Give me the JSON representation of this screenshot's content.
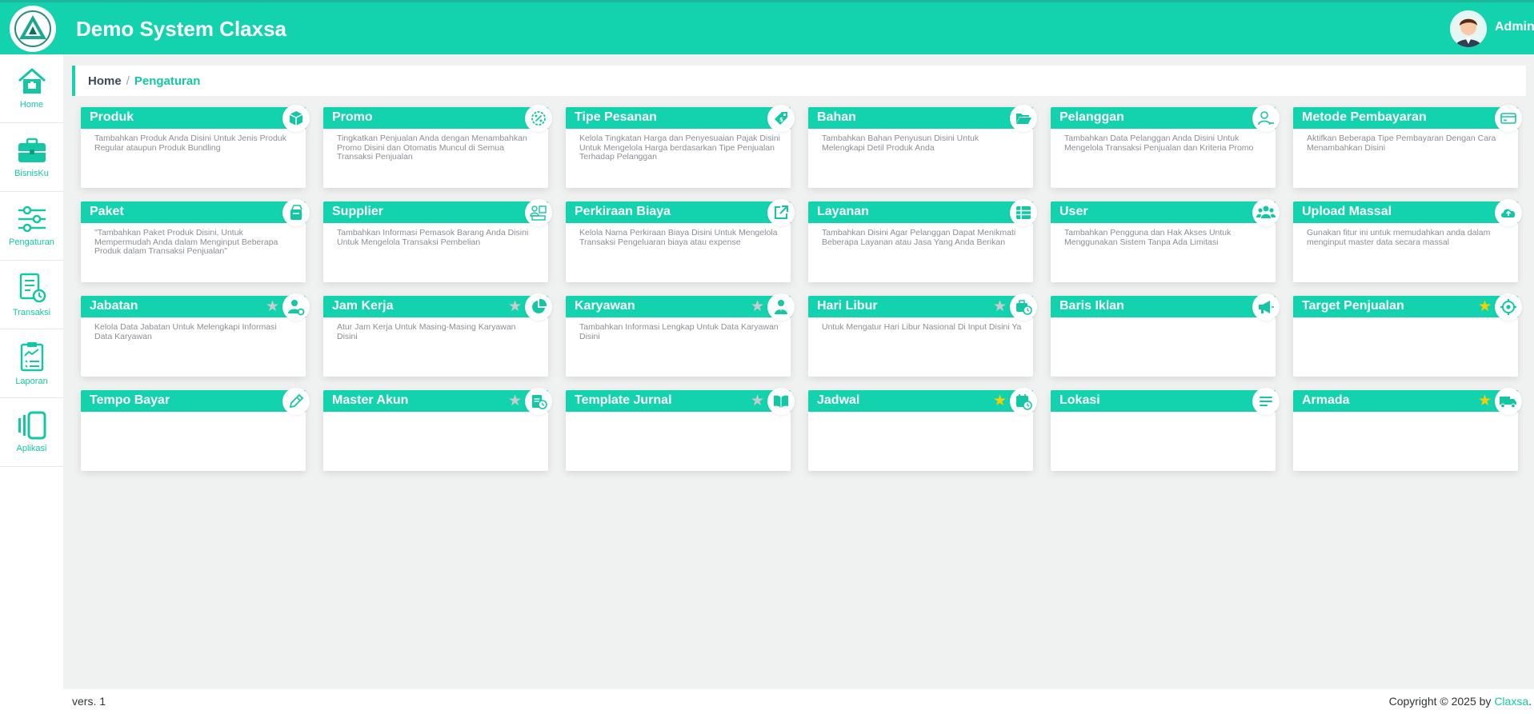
{
  "app": {
    "title": "Demo System Claxsa"
  },
  "user": {
    "name": "Admin"
  },
  "theme": {
    "accent": "#13d3ae",
    "star_active": "#f4d000",
    "star_inactive": "#c9cccb"
  },
  "sidebar": {
    "items": [
      {
        "label": "Home",
        "icon": "home-icon"
      },
      {
        "label": "BisnisKu",
        "icon": "briefcase-icon"
      },
      {
        "label": "Pengaturan",
        "icon": "sliders-icon"
      },
      {
        "label": "Transaksi",
        "icon": "receipt-icon"
      },
      {
        "label": "Laporan",
        "icon": "clipboard-chart-icon"
      },
      {
        "label": "Aplikasi",
        "icon": "apps-icon"
      }
    ]
  },
  "breadcrumb": {
    "home": "Home",
    "separator": "/",
    "current": "Pengaturan"
  },
  "cards": [
    {
      "title": "Produk",
      "desc": "Tambahkan Produk Anda Disini Untuk Jenis Produk Regular ataupun Produk Bundling",
      "icon": "box-icon",
      "star": "none"
    },
    {
      "title": "Promo",
      "desc": "Tingkatkan Penjualan Anda dengan Menambahkan Promo Disini dan Otomatis Muncul di Semua Transaksi Penjualan",
      "icon": "discount-badge-icon",
      "star": "none"
    },
    {
      "title": "Tipe Pesanan",
      "desc": "Kelola Tingkatan Harga dan Penyesuaian Pajak Disini Untuk Mengelola Harga berdasarkan Tipe Penjualan Terhadap Pelanggan",
      "icon": "price-tag-icon",
      "star": "none"
    },
    {
      "title": "Bahan",
      "desc": "Tambahkan Bahan Penyusun Disini Untuk Melengkapi Detil Produk Anda",
      "icon": "folder-open-icon",
      "star": "none"
    },
    {
      "title": "Pelanggan",
      "desc": "Tambahkan Data Pelanggan Anda Disini Untuk Mengelola Transaksi Penjualan dan Kriteria Promo",
      "icon": "user-outline-icon",
      "star": "none"
    },
    {
      "title": "Metode Pembayaran",
      "desc": "Aktifkan Beberapa Tipe Pembayaran Dengan Cara Menambahkan Disini",
      "icon": "credit-card-icon",
      "star": "none"
    },
    {
      "title": "Paket",
      "desc": "\"Tambahkan Paket Produk Disini, Untuk Mempermudah Anda dalam Menginput Beberapa Produk dalam Transaksi Penjualan\"",
      "icon": "package-icon",
      "star": "none"
    },
    {
      "title": "Supplier",
      "desc": "Tambahkan Informasi Pemasok Barang Anda Disini Untuk Mengelola Transaksi Pembelian",
      "icon": "supplier-icon",
      "star": "none"
    },
    {
      "title": "Perkiraan Biaya",
      "desc": "Kelola Nama Perkiraan Biaya Disini Untuk Mengelola Transaksi Pengeluaran biaya atau expense",
      "icon": "external-link-icon",
      "star": "none"
    },
    {
      "title": "Layanan",
      "desc": "Tambahkan Disini Agar Pelanggan Dapat Menikmati Beberapa Layanan atau Jasa Yang Anda Berikan",
      "icon": "table-list-icon",
      "star": "none"
    },
    {
      "title": "User",
      "desc": "Tambahkan Pengguna dan Hak Akses Untuk Menggunakan Sistem Tanpa Ada Limitasi",
      "icon": "users-icon",
      "star": "none"
    },
    {
      "title": "Upload Massal",
      "desc": "Gunakan fitur ini untuk memudahkan anda dalam menginput master data secara massal",
      "icon": "cloud-upload-icon",
      "star": "none"
    },
    {
      "title": "Jabatan",
      "desc": "Kelola Data Jabatan Untuk Melengkapi Informasi Data Karyawan",
      "icon": "user-cog-icon",
      "star": "inactive"
    },
    {
      "title": "Jam Kerja",
      "desc": "Atur Jam Kerja Untuk Masing-Masing Karyawan Disini",
      "icon": "pie-chart-icon",
      "star": "inactive"
    },
    {
      "title": "Karyawan",
      "desc": "Tambahkan Informasi Lengkap Untuk Data Karyawan Disini",
      "icon": "person-icon",
      "star": "inactive"
    },
    {
      "title": "Hari Libur",
      "desc": "Untuk Mengatur Hari Libur Nasional Di Input Disini Ya",
      "icon": "briefcase-clock-icon",
      "star": "inactive"
    },
    {
      "title": "Baris Iklan",
      "desc": "",
      "icon": "megaphone-icon",
      "star": "none"
    },
    {
      "title": "Target Penjualan",
      "desc": "",
      "icon": "target-icon",
      "star": "active"
    },
    {
      "title": "Tempo Bayar",
      "desc": "",
      "icon": "pencil-icon",
      "star": "none"
    },
    {
      "title": "Master Akun",
      "desc": "",
      "icon": "account-file-icon",
      "star": "inactive"
    },
    {
      "title": "Template Jurnal",
      "desc": "",
      "icon": "open-book-icon",
      "star": "inactive"
    },
    {
      "title": "Jadwal",
      "desc": "",
      "icon": "calendar-clock-icon",
      "star": "active"
    },
    {
      "title": "Lokasi",
      "desc": "",
      "icon": "align-left-icon",
      "star": "none"
    },
    {
      "title": "Armada",
      "desc": "",
      "icon": "truck-icon",
      "star": "active"
    }
  ],
  "footer": {
    "version": "vers. 1",
    "copyright_prefix": "Copyright © 2025 by ",
    "brand": "Claxsa",
    "suffix": "."
  }
}
